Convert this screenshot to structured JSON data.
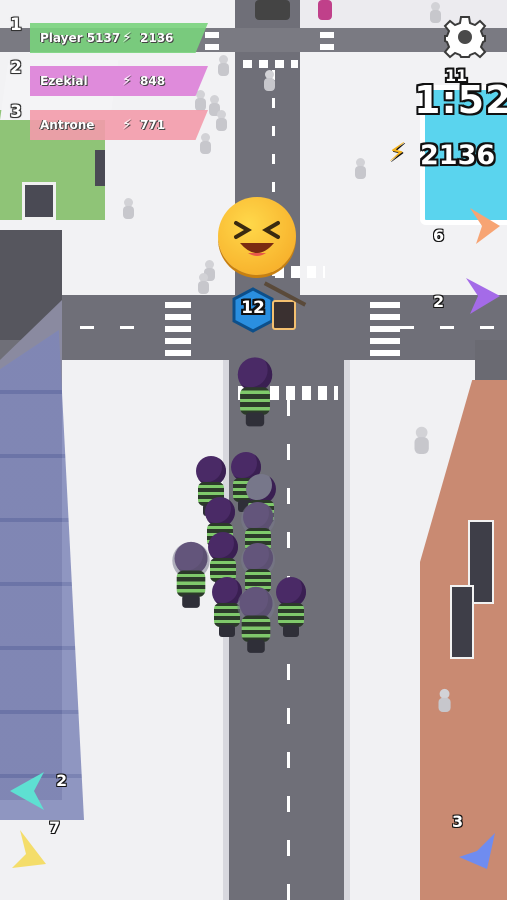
{
  "leaderboard": [
    {
      "rank": "1",
      "name": "Player 5137",
      "score": "2136",
      "color": "#79d37c"
    },
    {
      "rank": "2",
      "name": "Ezekial",
      "score": "848",
      "color": "#dd7fd8"
    },
    {
      "rank": "3",
      "name": "Antrone",
      "score": "771",
      "color": "#f39bab"
    }
  ],
  "hud": {
    "settings_icon": "gear-icon",
    "players_left": "11",
    "timer": "1:52",
    "score": "2136",
    "score_icon": "lightning-icon"
  },
  "crowd": {
    "count": "12",
    "emoji": "laughing-face",
    "badge_color": "#2a8fe0"
  },
  "offscreen_players": [
    {
      "count": "6",
      "color": "#f7a473",
      "side": "right"
    },
    {
      "count": "2",
      "color": "#a46be8",
      "side": "right"
    },
    {
      "count": "2",
      "color": "#5ee0d2",
      "side": "left"
    },
    {
      "count": "7",
      "color": "#f4dd6a",
      "side": "left"
    },
    {
      "count": "3",
      "color": "#6f8cf0",
      "side": "right"
    }
  ]
}
